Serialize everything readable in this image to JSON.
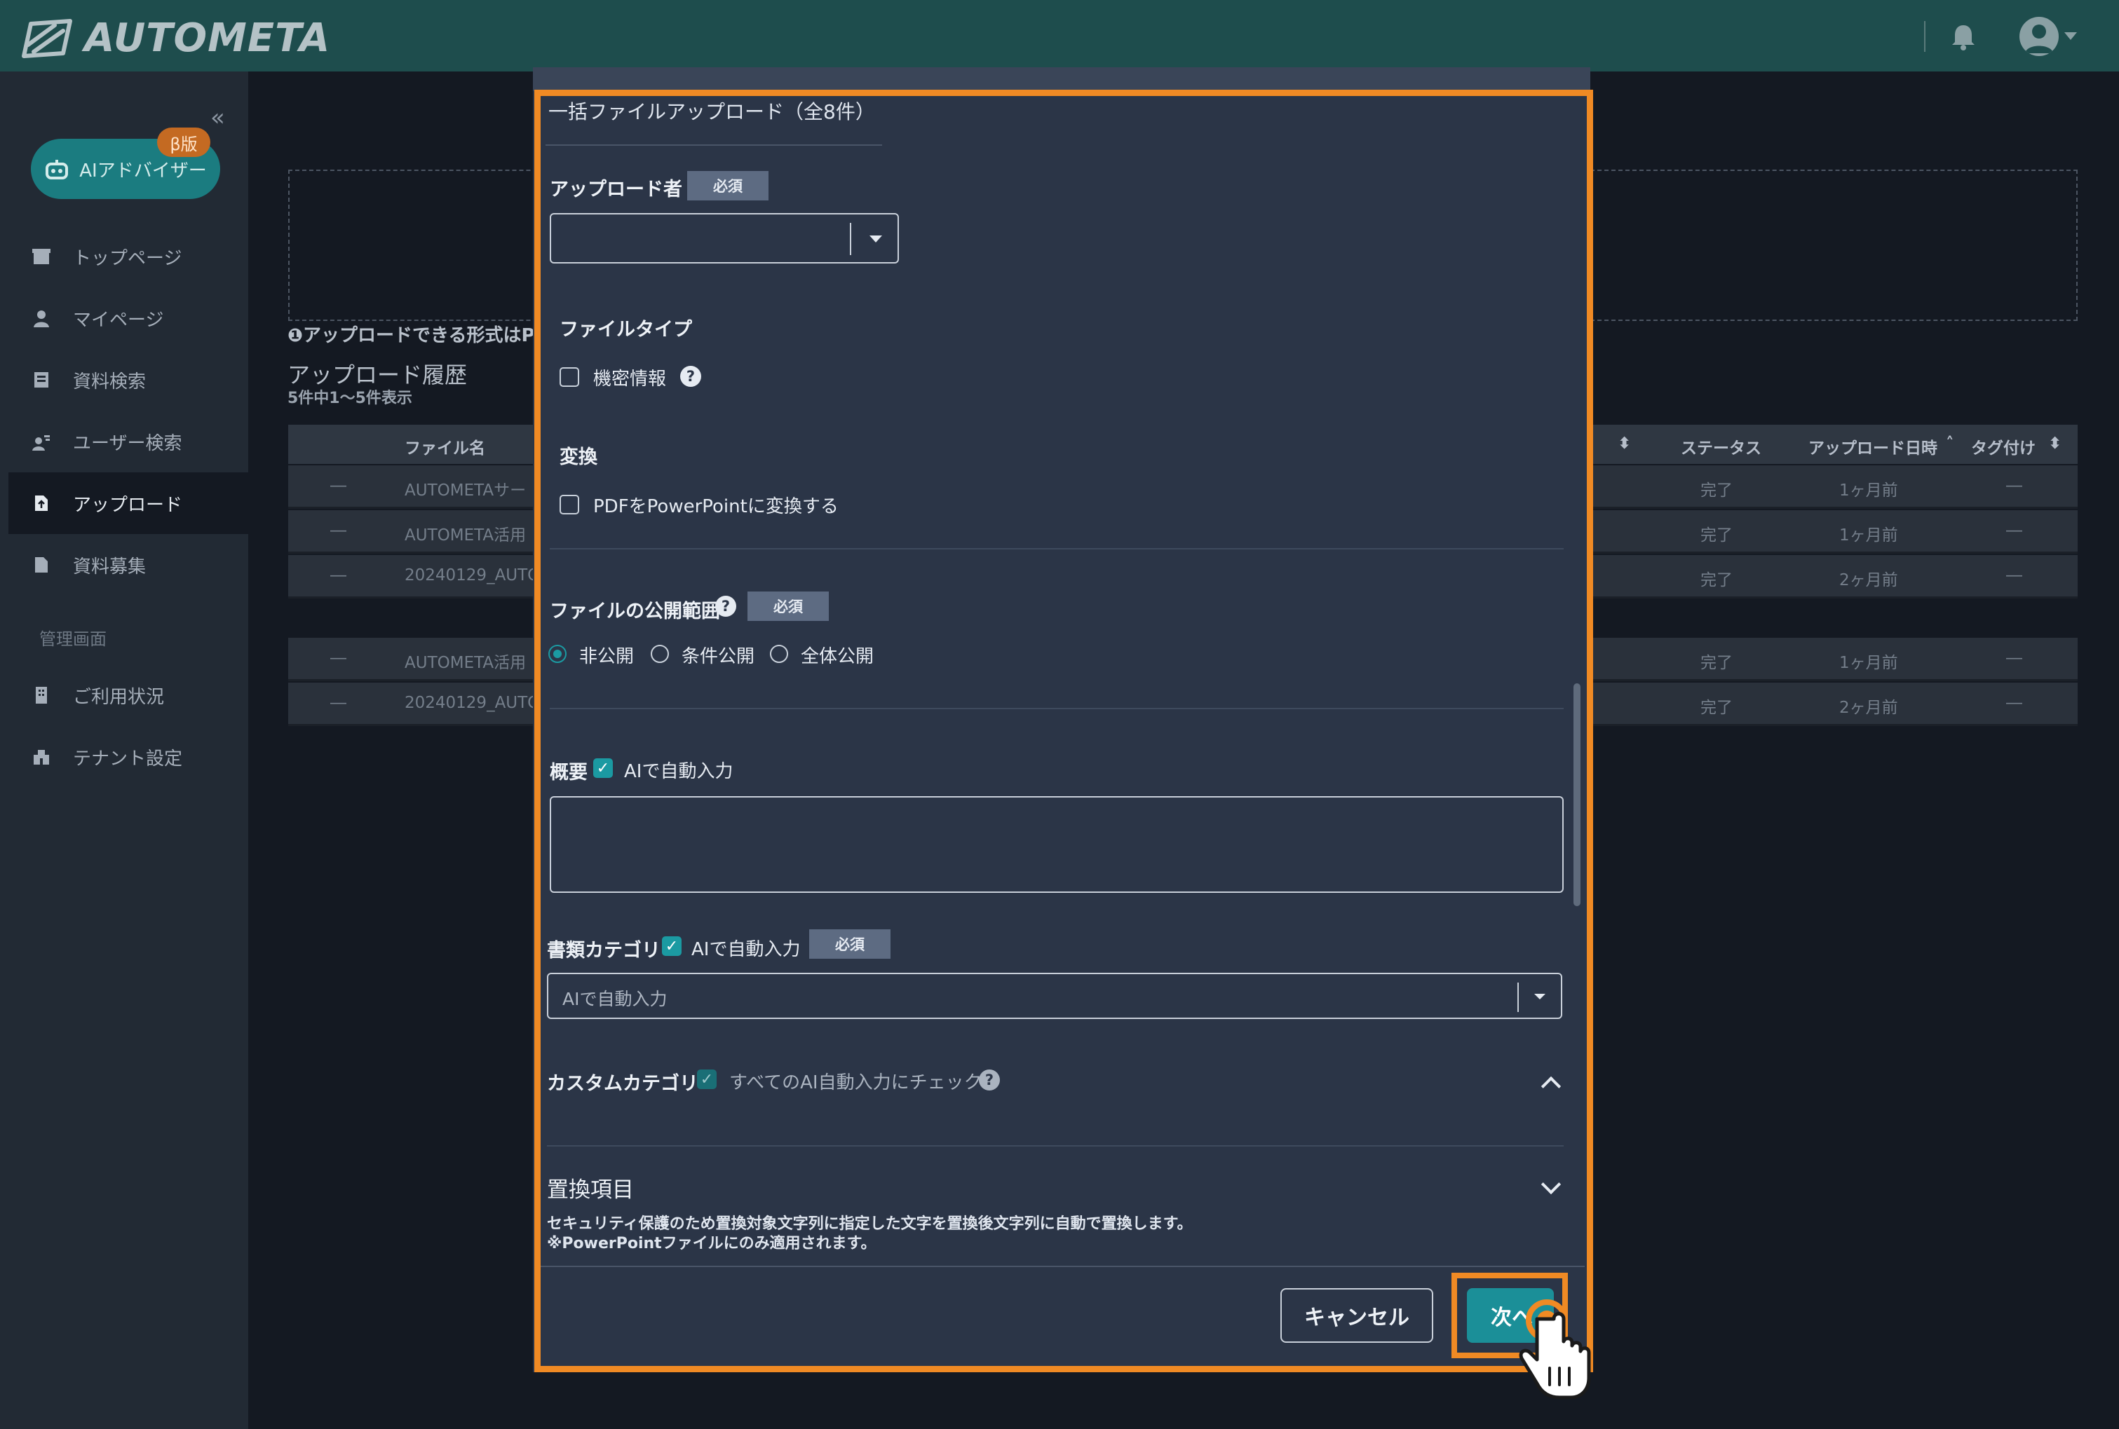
{
  "header": {
    "brand": "AUTOMETA",
    "icons": {
      "logo": "autometa-logo-icon",
      "notifications": "bell-icon",
      "account": "user-avatar-icon"
    }
  },
  "sidebar": {
    "ai_advisor": {
      "label": "AIアドバイザー",
      "badge": "β版"
    },
    "items": [
      {
        "label": "トップページ",
        "icon": "home-icon"
      },
      {
        "label": "マイページ",
        "icon": "user-icon"
      },
      {
        "label": "資料検索",
        "icon": "document-search-icon"
      },
      {
        "label": "ユーザー検索",
        "icon": "users-icon"
      },
      {
        "label": "アップロード",
        "icon": "upload-icon",
        "active": true
      },
      {
        "label": "資料募集",
        "icon": "file-icon"
      }
    ],
    "admin_section": "管理画面",
    "admin_items": [
      {
        "label": "ご利用状況",
        "icon": "building-icon"
      },
      {
        "label": "テナント設定",
        "icon": "settings-building-icon"
      }
    ]
  },
  "main": {
    "formats_note": "❶アップロードできる形式はP",
    "history_title": "アップロード履歴",
    "history_count": "5件中1〜5件表示",
    "table": {
      "headers": [
        "ファイル名",
        "ステータス",
        "アップロード日時",
        "タグ付け"
      ],
      "rows": [
        {
          "dash": "―",
          "name": "AUTOMETAサー",
          "status": "完了",
          "date": "1ヶ月前",
          "tag": "―"
        },
        {
          "dash": "―",
          "name": "AUTOMETA活用",
          "status": "完了",
          "date": "1ヶ月前",
          "tag": "―"
        },
        {
          "dash": "―",
          "name": "20240129_AUTO",
          "status": "完了",
          "date": "2ヶ月前",
          "tag": "―"
        },
        {
          "dash": "―",
          "name": "AUTOMETA活用",
          "status": "完了",
          "date": "1ヶ月前",
          "tag": "―"
        },
        {
          "dash": "―",
          "name": "20240129_AUTO",
          "status": "完了",
          "date": "2ヶ月前",
          "tag": "―"
        }
      ]
    }
  },
  "modal": {
    "title": "一括ファイルアップロード（全8件）",
    "uploader": {
      "label": "アップロード者",
      "required": "必須",
      "value": ""
    },
    "file_type": {
      "label": "ファイルタイプ",
      "option": "機密情報",
      "checked": false
    },
    "convert": {
      "label": "変換",
      "option": "PDFをPowerPointに変換する",
      "checked": false
    },
    "visibility": {
      "label": "ファイルの公開範囲",
      "required": "必須",
      "options": [
        {
          "label": "非公開",
          "selected": true
        },
        {
          "label": "条件公開",
          "selected": false
        },
        {
          "label": "全体公開",
          "selected": false
        }
      ]
    },
    "summary": {
      "label": "概要",
      "auto": "AIで自動入力",
      "checked": true,
      "value": ""
    },
    "doc_category": {
      "label": "書類カテゴリ",
      "auto": "AIで自動入力",
      "required": "必須",
      "placeholder": "AIで自動入力"
    },
    "custom_category": {
      "label": "カスタムカテゴリ",
      "check_all": "すべてのAI自動入力にチェック"
    },
    "replace": {
      "label": "置換項目",
      "note1": "セキュリティ保護のため置換対象文字列に指定した文字を置換後文字列に自動で置換します。",
      "note2": "※PowerPointファイルにのみ適用されます。"
    },
    "buttons": {
      "cancel": "キャンセル",
      "next": "次へ"
    }
  },
  "colors": {
    "accent": "#1b9aa2",
    "highlight": "#f08a24",
    "header": "#1e4d4d",
    "beta": "#c46a22"
  }
}
